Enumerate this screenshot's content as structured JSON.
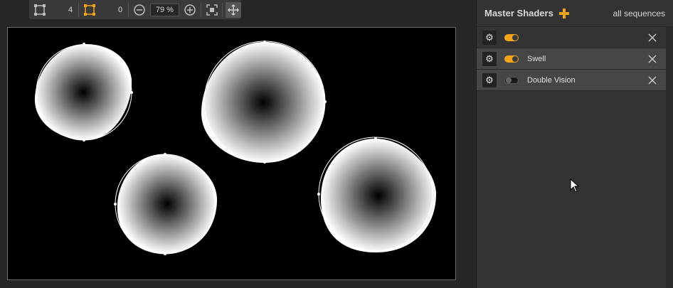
{
  "toolbar": {
    "vertex_count": "4",
    "handle_count": "0",
    "zoom_value": "79 %",
    "icons": [
      "shape-vertices-icon",
      "shape-handles-icon",
      "zoom-out-icon",
      "zoom-in-icon",
      "fit-frame-icon",
      "move-icon"
    ]
  },
  "colors": {
    "accent": "#f2a41c",
    "panel_bg": "#333333",
    "workspace_bg": "#262626",
    "canvas_bg": "#000000"
  },
  "panel": {
    "title": "Master Shaders",
    "scope": "all sequences",
    "rows": [
      {
        "label": "",
        "enabled": true,
        "selected": false
      },
      {
        "label": "Swell",
        "enabled": true,
        "selected": true
      },
      {
        "label": "Double Vision",
        "enabled": false,
        "selected": true
      }
    ]
  }
}
